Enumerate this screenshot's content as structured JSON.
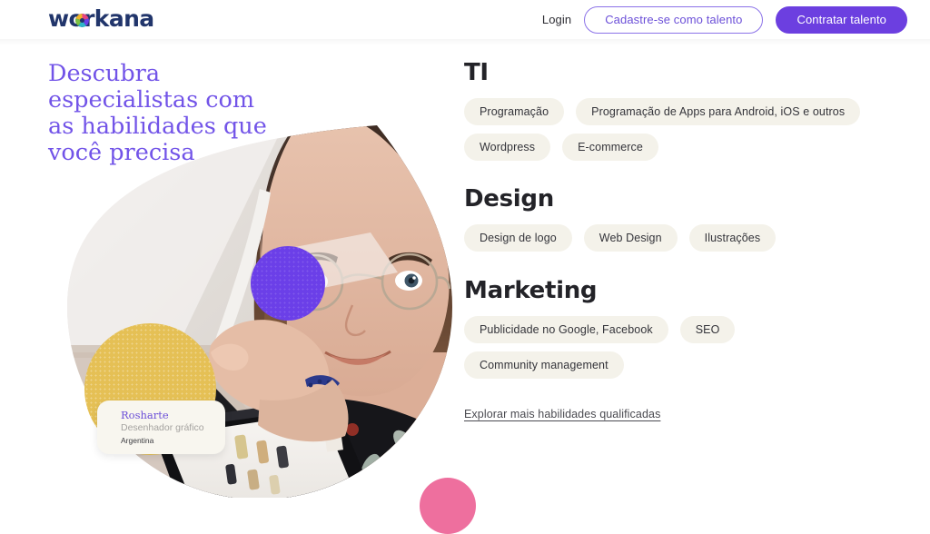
{
  "header": {
    "logo_text": "workana",
    "logo_icon": "workana-circle-mark",
    "login_label": "Login",
    "signup_label": "Cadastre-se como talento",
    "hire_label": "Contratar talento",
    "colors": {
      "logo_navy": "#21356b",
      "outline_purple": "#6b4fd8",
      "solid_purple": "#6c3fe0"
    }
  },
  "hero": {
    "headline": "Descubra especialistas com as habilidades que você precisa",
    "headline_color": "#7254e8",
    "photo_alt": "mulher com óculos desenhando em tablet",
    "shapes": {
      "yellow": "#e5c055",
      "purple": "#6b3fe8",
      "pink": "#ee6f9e"
    },
    "profile_card": {
      "name": "Rosharte",
      "role": "Desenhador gráfico",
      "country": "Argentina"
    }
  },
  "skills": {
    "sections": [
      {
        "title": "TI",
        "pills": [
          "Programação",
          "Programação de Apps para Android, iOS e outros",
          "Wordpress",
          "E-commerce"
        ]
      },
      {
        "title": "Design",
        "pills": [
          "Design de logo",
          "Web Design",
          "Ilustrações"
        ]
      },
      {
        "title": "Marketing",
        "pills": [
          "Publicidade no Google, Facebook",
          "SEO",
          "Community management"
        ]
      }
    ],
    "explore_label": "Explorar mais habilidades qualificadas"
  }
}
